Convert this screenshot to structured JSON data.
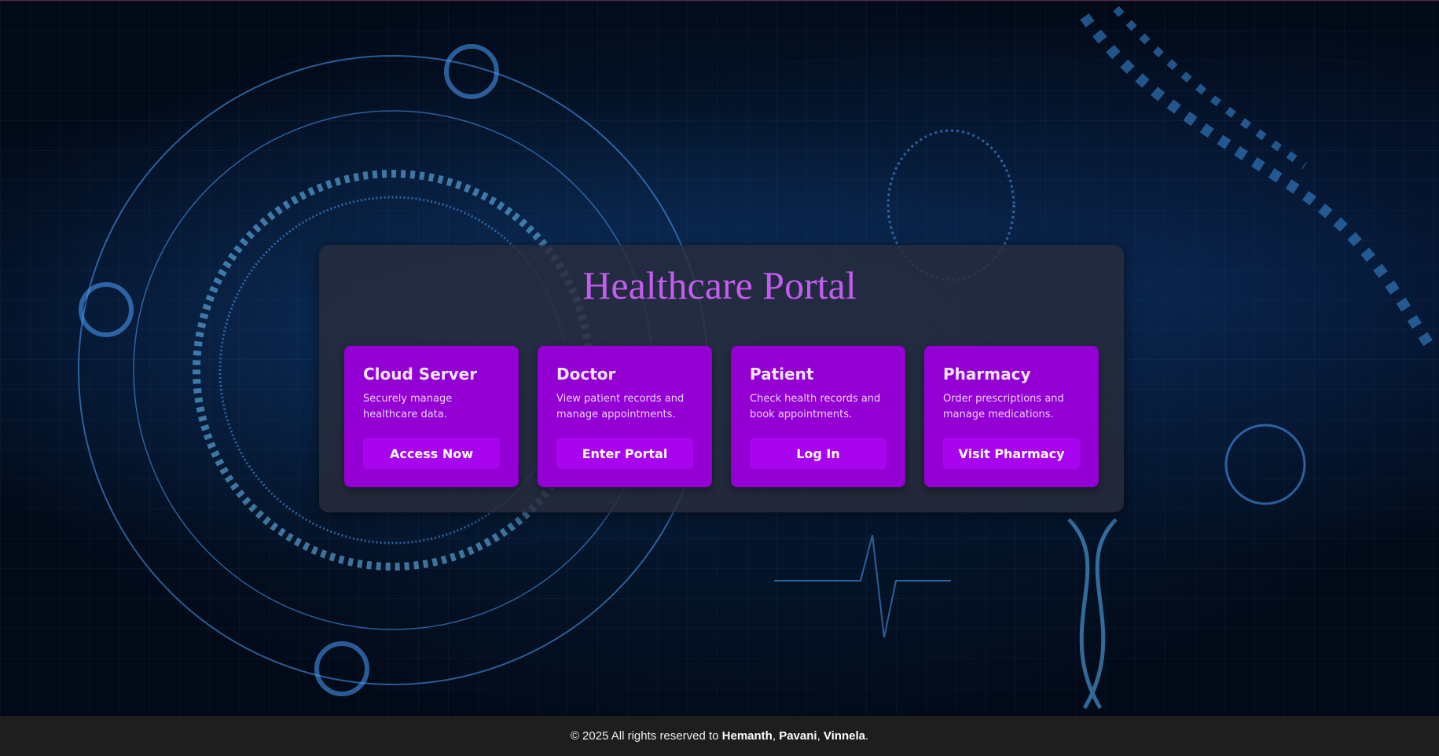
{
  "title": "Healthcare Portal",
  "cards": [
    {
      "heading": "Cloud Server",
      "description": "Securely manage healthcare data.",
      "button": "Access Now"
    },
    {
      "heading": "Doctor",
      "description": "View patient records and manage appointments.",
      "button": "Enter Portal"
    },
    {
      "heading": "Patient",
      "description": "Check health records and book appointments.",
      "button": "Log In"
    },
    {
      "heading": "Pharmacy",
      "description": "Order prescriptions and manage medications.",
      "button": "Visit Pharmacy"
    }
  ],
  "footer": {
    "prefix": "© 2025 All rights reserved to ",
    "names": [
      "Hemanth",
      "Pavani",
      "Vinnela"
    ],
    "sep": ", ",
    "end": "."
  },
  "colors": {
    "accent": "#c45cf0",
    "card": "#9400d3",
    "button": "#a805ee",
    "footer": "#1e1e1e"
  }
}
